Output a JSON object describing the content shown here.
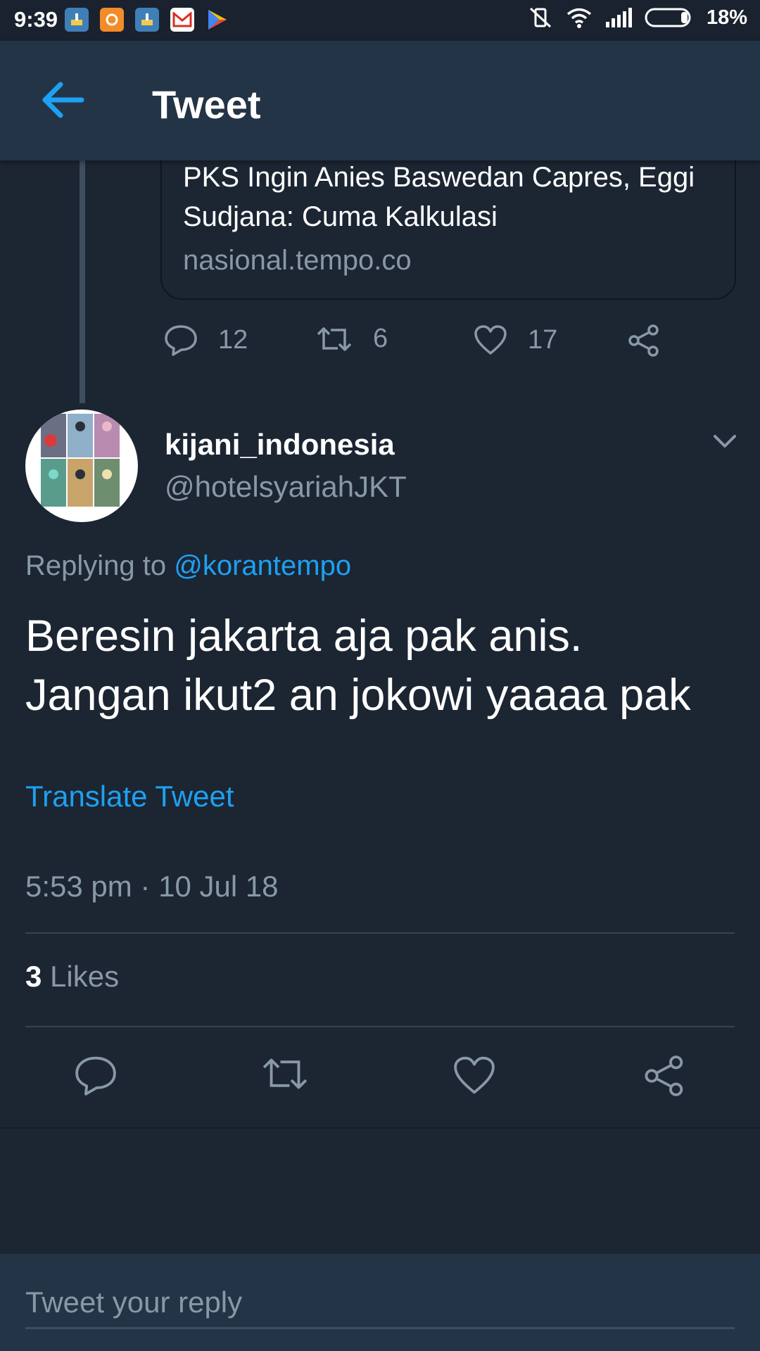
{
  "status_bar": {
    "time": "9:39",
    "battery": "18%"
  },
  "app_bar": {
    "title": "Tweet"
  },
  "quoted_card": {
    "title": "PKS Ingin Anies Baswedan Capres, Eggi Sudjana: Cuma Kalkulasi",
    "domain": "nasional.tempo.co"
  },
  "previous_tweet_actions": {
    "replies": "12",
    "retweets": "6",
    "likes": "17"
  },
  "tweet": {
    "display_name": "kijani_indonesia",
    "handle": "@hotelsyariahJKT",
    "replying_prefix": "Replying to",
    "replying_to": "@korantempo",
    "text_line1": "Beresin jakarta aja pak anis.",
    "text_line2": "Jangan ikut2 an jokowi yaaaa pak",
    "translate_label": "Translate Tweet",
    "timestamp": "5:53 pm · 10 Jul 18",
    "likes_count": "3",
    "likes_label": "Likes"
  },
  "reply": {
    "placeholder": "Tweet your reply"
  },
  "colors": {
    "background": "#1c2532",
    "bar": "#243447",
    "accent": "#1da1f2",
    "muted": "#8899a6"
  },
  "icons": [
    "back-arrow-icon",
    "reply-icon",
    "retweet-icon",
    "heart-icon",
    "share-icon",
    "chevron-down-icon"
  ]
}
